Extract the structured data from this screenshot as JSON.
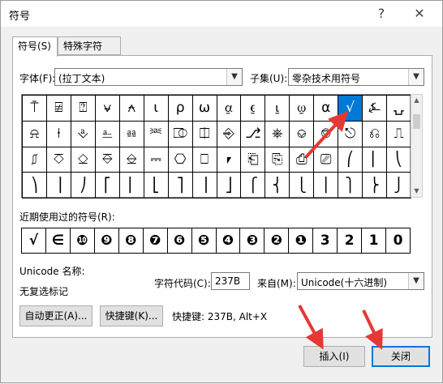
{
  "window": {
    "title": "符号",
    "help_glyph": "?",
    "close_glyph": "✕"
  },
  "tabs": [
    {
      "label": "符号(S)",
      "active": true
    },
    {
      "label": "特殊字符(P)",
      "active": false
    }
  ],
  "font": {
    "label": "字体(F):",
    "value": "(拉丁文本)"
  },
  "subset": {
    "label": "子集(U):",
    "value": "零杂技术用符号"
  },
  "symbols": [
    [
      "⍑",
      "⍯",
      "⍰",
      "⍱",
      "⍲",
      "⍳",
      "⍴",
      "⍵",
      "⍶",
      "⍷",
      "⍸",
      "⍹",
      "⍺",
      "√",
      "⍼",
      "⍽"
    ],
    [
      "⍾",
      "⍿",
      "⎀",
      "⎁",
      "⎂",
      "⎃",
      "⎄",
      "⎅",
      "⎆",
      "⎇",
      "⎈",
      "⎉",
      "⎊",
      "⎋",
      "⎌",
      "⎍"
    ],
    [
      "⎎",
      "⎏",
      "⎐",
      "⎑",
      "⎒",
      "⎓",
      "⎔",
      "⎕",
      "⎖",
      "⎗",
      "⎘",
      "⎙",
      "⎚",
      "⎛",
      "⎜",
      "⎝"
    ],
    [
      "⎞",
      "⎟",
      "⎠",
      "⎡",
      "⎢",
      "⎣",
      "⎤",
      "⎥",
      "⎦",
      "⎧",
      "⎨",
      "⎩",
      "⎪",
      "⎫",
      "⎬",
      "⎭"
    ]
  ],
  "selected": {
    "row": 0,
    "col": 13
  },
  "recent": {
    "label": "近期使用过的符号(R):",
    "items": [
      "√",
      "∈",
      "❿",
      "❾",
      "❽",
      "❼",
      "❻",
      "❺",
      "❹",
      "❸",
      "❷",
      "❶",
      "3",
      "2",
      "1",
      "0"
    ]
  },
  "unicode_name_label": "Unicode 名称:",
  "unicode_name": "无复选标记",
  "char_code": {
    "label": "字符代码(C):",
    "value": "237B"
  },
  "from": {
    "label": "来自(M):",
    "value": "Unicode(十六进制)"
  },
  "buttons": {
    "autocorrect": "自动更正(A)...",
    "shortcut": "快捷键(K)...",
    "insert": "插入(I)",
    "close": "关闭"
  },
  "shortcut_text": "快捷键: 237B, Alt+X",
  "colors": {
    "accent": "#0078d7",
    "annotation": "#e53935"
  }
}
